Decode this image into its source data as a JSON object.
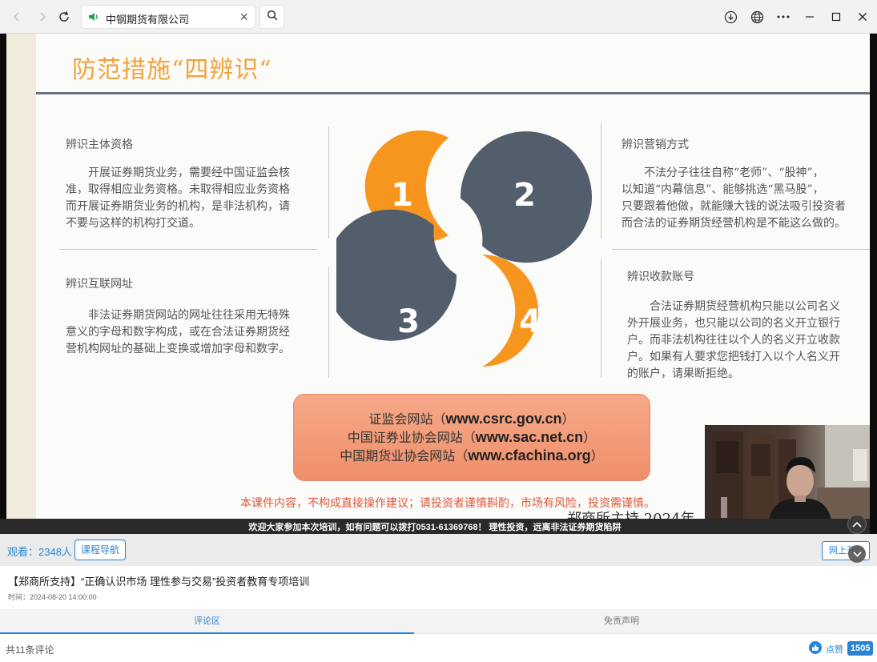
{
  "browser": {
    "tab_title": "中钢期货有限公司",
    "icons": [
      "back-icon",
      "forward-icon",
      "reload-icon",
      "speaker-icon",
      "close-icon",
      "search-icon",
      "download-icon",
      "globe-icon",
      "more-icon",
      "minimize-icon",
      "maximize-icon",
      "close-window-icon"
    ]
  },
  "slide": {
    "title": "防范措施“四辨识“",
    "sections": [
      {
        "heading": "辨识主体资格",
        "lines": [
          "开展证券期货业务，需要经中国证监会核",
          "准，取得相应业务资格。未取得相应业务资格",
          "而开展证券期货业务的机构，是非法机构，请",
          "不要与这样的机构打交道。"
        ]
      },
      {
        "heading": "辨识营销方式",
        "lines": [
          "不法分子往往自称“老师”、“股神”，",
          "以知道“内幕信息”、能够挑选“黑马股”，",
          "只要跟着他做，就能赚大钱的说法吸引投资者",
          "而合法的证券期货经营机构是不能这么做的。"
        ]
      },
      {
        "heading": "辨识互联网址",
        "lines": [
          "非法证券期货网站的网址往往采用无特殊",
          "意义的字母和数字构成，或在合法证券期货经",
          "营机构网址的基础上变换或增加字母和数字。"
        ]
      },
      {
        "heading": "辨识收款账号",
        "lines": [
          "合法证券期货经营机构只能以公司名义",
          "外开展业务，也只能以公司的名义开立银行",
          "户。而非法机构往往以个人的名义开立收款",
          "户。如果有人要求您把钱打入以个人名义开",
          "的账户，请果断拒绝。"
        ]
      }
    ],
    "petal_numbers": [
      "1",
      "2",
      "3",
      "4"
    ],
    "colors": {
      "orange": "#F7961F",
      "slate": "#535E6C",
      "title": "#F2A23A",
      "warning": "#E0573A"
    },
    "sites": [
      {
        "name": "证监会网站（",
        "url": "www.csrc.gov.cn",
        "close": "）"
      },
      {
        "name": "中国证券业协会网站（",
        "url": "www.sac.net.cn",
        "close": "）"
      },
      {
        "name": "中国期货业协会网站（",
        "url": "www.cfachina.org",
        "close": "）"
      }
    ],
    "disclaimer": "本课件内容，不构成直接操作建议；请投资者谨慎斟酌，市场有风险，投资需谨慎。",
    "footer_partial": "郑商所主持 2024年"
  },
  "ticker": "欢迎大家参加本次培训，如有问题可以拨打0531-61369768！ 理性投资，远离非法证券期货陷阱",
  "viewbar": {
    "viewers": "观看：2348人",
    "course_nav": "课程导航",
    "online_btn": "网上开户"
  },
  "course": {
    "title": "【郑商所支持】“正确认识市场 理性参与交易”投资者教育专项培训",
    "time": "时间：2024-08-20 14:00:00"
  },
  "tabs": [
    {
      "label": "评论区",
      "active": true
    },
    {
      "label": "免责声明",
      "active": false
    }
  ],
  "comments": {
    "count_text": "共11条评论",
    "like_label": "点赞",
    "like_count": "1505"
  }
}
